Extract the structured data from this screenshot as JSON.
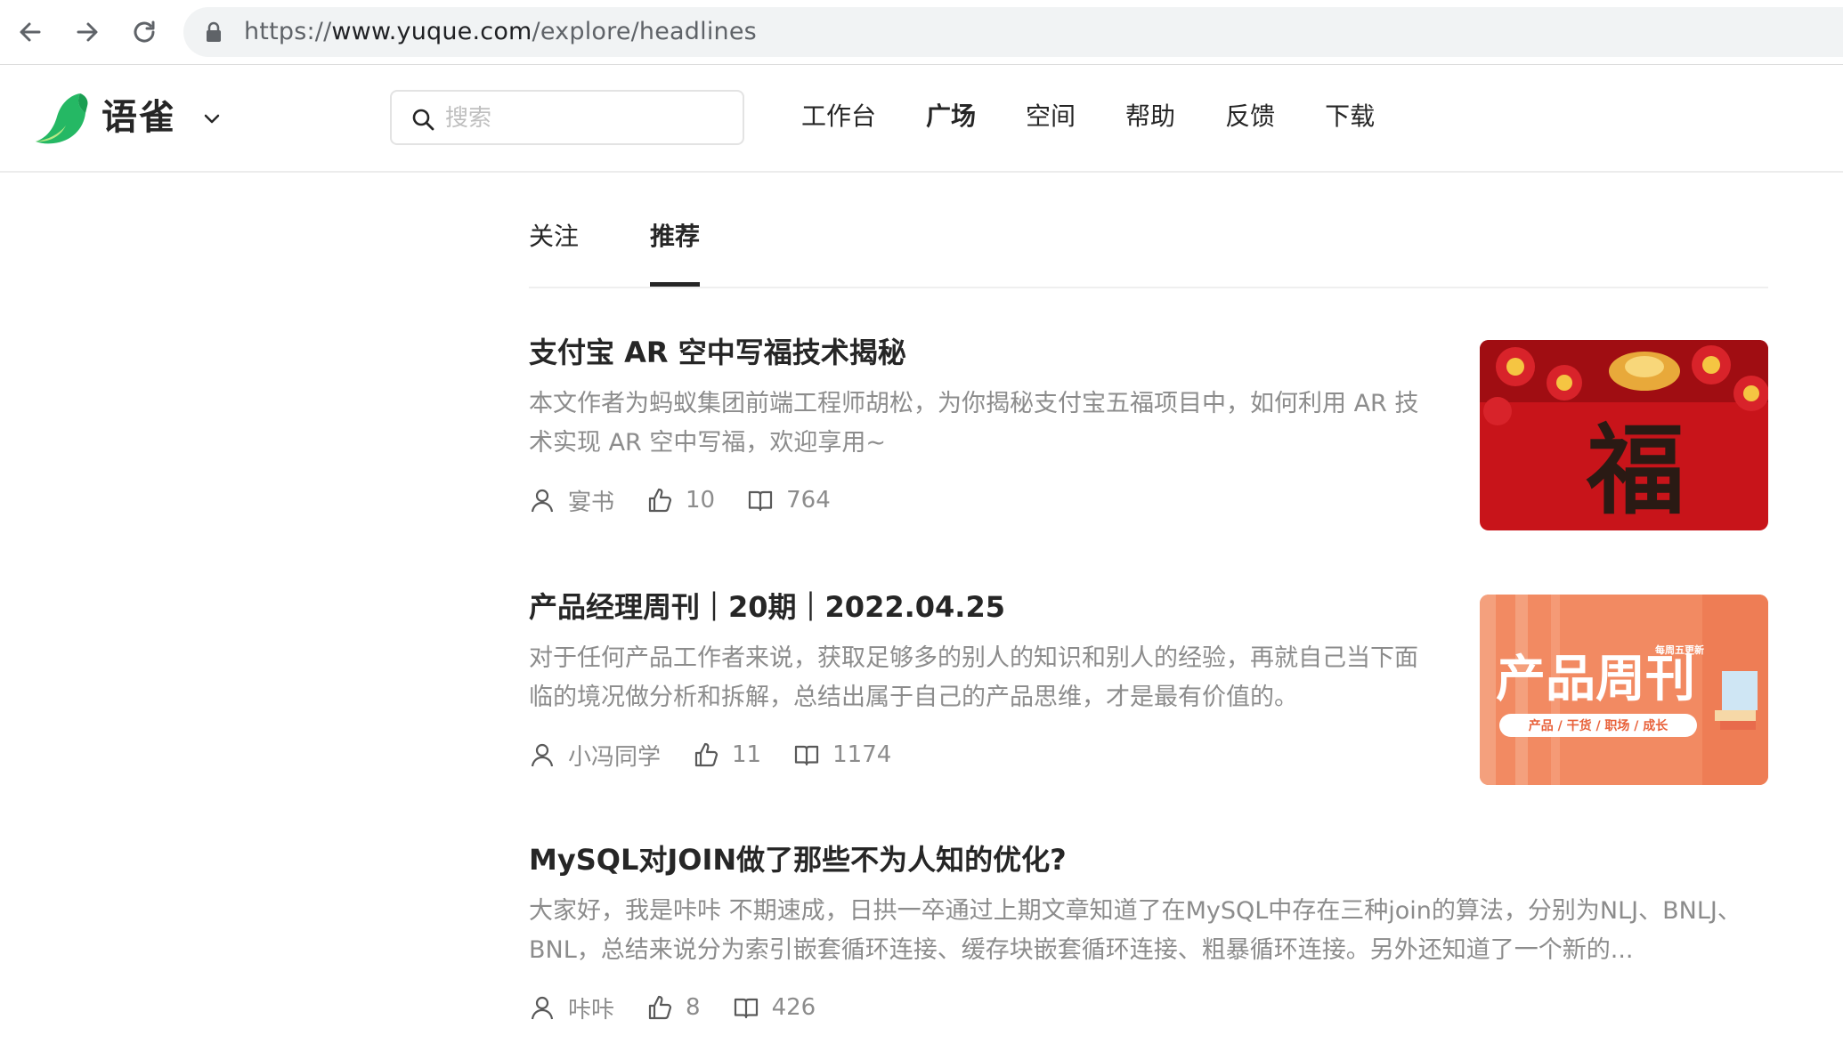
{
  "browser": {
    "url_scheme": "https://",
    "url_host": "www.yuque.com",
    "url_path": "/explore/headlines"
  },
  "header": {
    "brand": "语雀",
    "search_placeholder": "搜索",
    "nav": [
      "工作台",
      "广场",
      "空间",
      "帮助",
      "反馈",
      "下载"
    ],
    "active_nav": "广场"
  },
  "tabs": [
    "关注",
    "推荐"
  ],
  "active_tab": "推荐",
  "articles": [
    {
      "title": "支付宝 AR 空中写福技术揭秘",
      "summary": "本文作者为蚂蚁集团前端工程师胡松，为你揭秘支付宝五福项目中，如何利用 AR 技术实现 AR 空中写福，欢迎享用~",
      "author": "宴书",
      "likes": "10",
      "reads": "764",
      "cover_text": "福"
    },
    {
      "title": "产品经理周刊｜20期｜2022.04.25",
      "summary": "对于任何产品工作者来说，获取足够多的别人的知识和别人的经验，再就自己当下面临的境况做分析和拆解，总结出属于自己的产品思维，才是最有价值的。",
      "author": "小冯同学",
      "likes": "11",
      "reads": "1174",
      "cover_text": "产品周刊",
      "cover_badge": "每周五更新",
      "cover_tags": "产品 / 干货 / 职场 / 成长"
    },
    {
      "title": "MySQL对JOIN做了那些不为人知的优化?",
      "summary": "大家好，我是咔咔 不期速成，日拱一卒通过上期文章知道了在MySQL中存在三种join的算法，分别为NLJ、BNLJ、BNL，总结来说分为索引嵌套循环连接、缓存块嵌套循环连接、粗暴循环连接。另外还知道了一个新的...",
      "author": "咔咔",
      "likes": "8",
      "reads": "426"
    }
  ],
  "colors": {
    "brand_green": "#25b864",
    "text_primary": "#262626",
    "text_secondary": "#8c8c8c"
  }
}
